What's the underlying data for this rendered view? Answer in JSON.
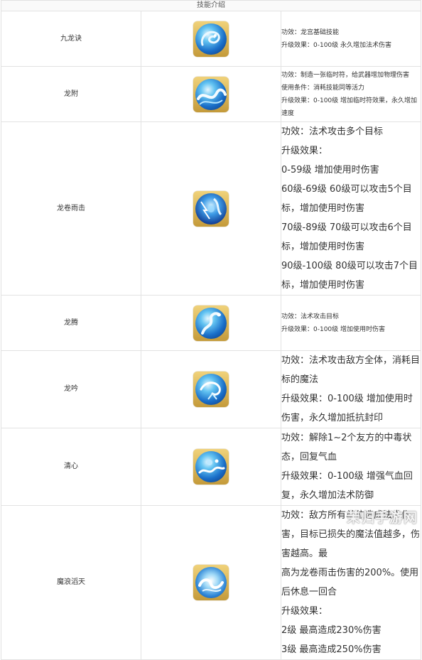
{
  "table": {
    "header": "技能介绍",
    "rows": [
      {
        "name": "九龙诀",
        "icon": "dragon-swirl-icon",
        "lines": [
          "功效：龙宫基础技能",
          "升级效果：0-100级 永久增加法术伤害"
        ]
      },
      {
        "name": "龙附",
        "icon": "water-wave-icon",
        "lines": [
          "功效：制造一张临时符，给武器增加物理伤害",
          "使用条件：消耗技能同等活力",
          "升级效果：0-100级 增加临时符效果，永久增加速度"
        ]
      },
      {
        "name": "龙卷雨击",
        "icon": "dragon-storm-icon",
        "lines": [
          "功效：法术攻击多个目标",
          "升级效果：",
          "0-59级 增加使用时伤害",
          "60级-69级 60级可以攻击5个目标，增加使用时伤害",
          "70级-89级 70级可以攻击6个目标，增加使用时伤害",
          "90级-100级 80级可以攻击7个目标，增加使用时伤害"
        ]
      },
      {
        "name": "龙腾",
        "icon": "rising-dragon-icon",
        "lines": [
          "功效：法术攻击目标",
          "升级效果：0-100级 增加使用时伤害"
        ]
      },
      {
        "name": "龙吟",
        "icon": "dragon-roar-icon",
        "lines": [
          "功效：法术攻击敌方全体，消耗目标的魔法",
          "升级效果：0-100级 增加使用时伤害，永久增加抵抗封印"
        ]
      },
      {
        "name": "清心",
        "icon": "cleanse-wave-icon",
        "lines": [
          "功效：解除1~2个友方的中毒状态，回复气血",
          "升级效果：0-100级 增强气血回复，永久增加法术防御"
        ]
      },
      {
        "name": "魔浪滔天",
        "icon": "tidal-wave-icon",
        "lines": [
          "功效：敌方所有单位造成法术伤害，目标已损失的魔法值越多，伤害越高。最",
          "高为龙卷雨击伤害的200%。使用后休息一回合",
          "升级效果：",
          "2级 最高造成230%伤害",
          "3级 最高造成250%伤害"
        ]
      }
    ]
  },
  "watermark": "茉归手游网",
  "colors": {
    "border": "#e2e2e2",
    "frame": "#d4ad4f",
    "orb": "#1a6fc9"
  }
}
